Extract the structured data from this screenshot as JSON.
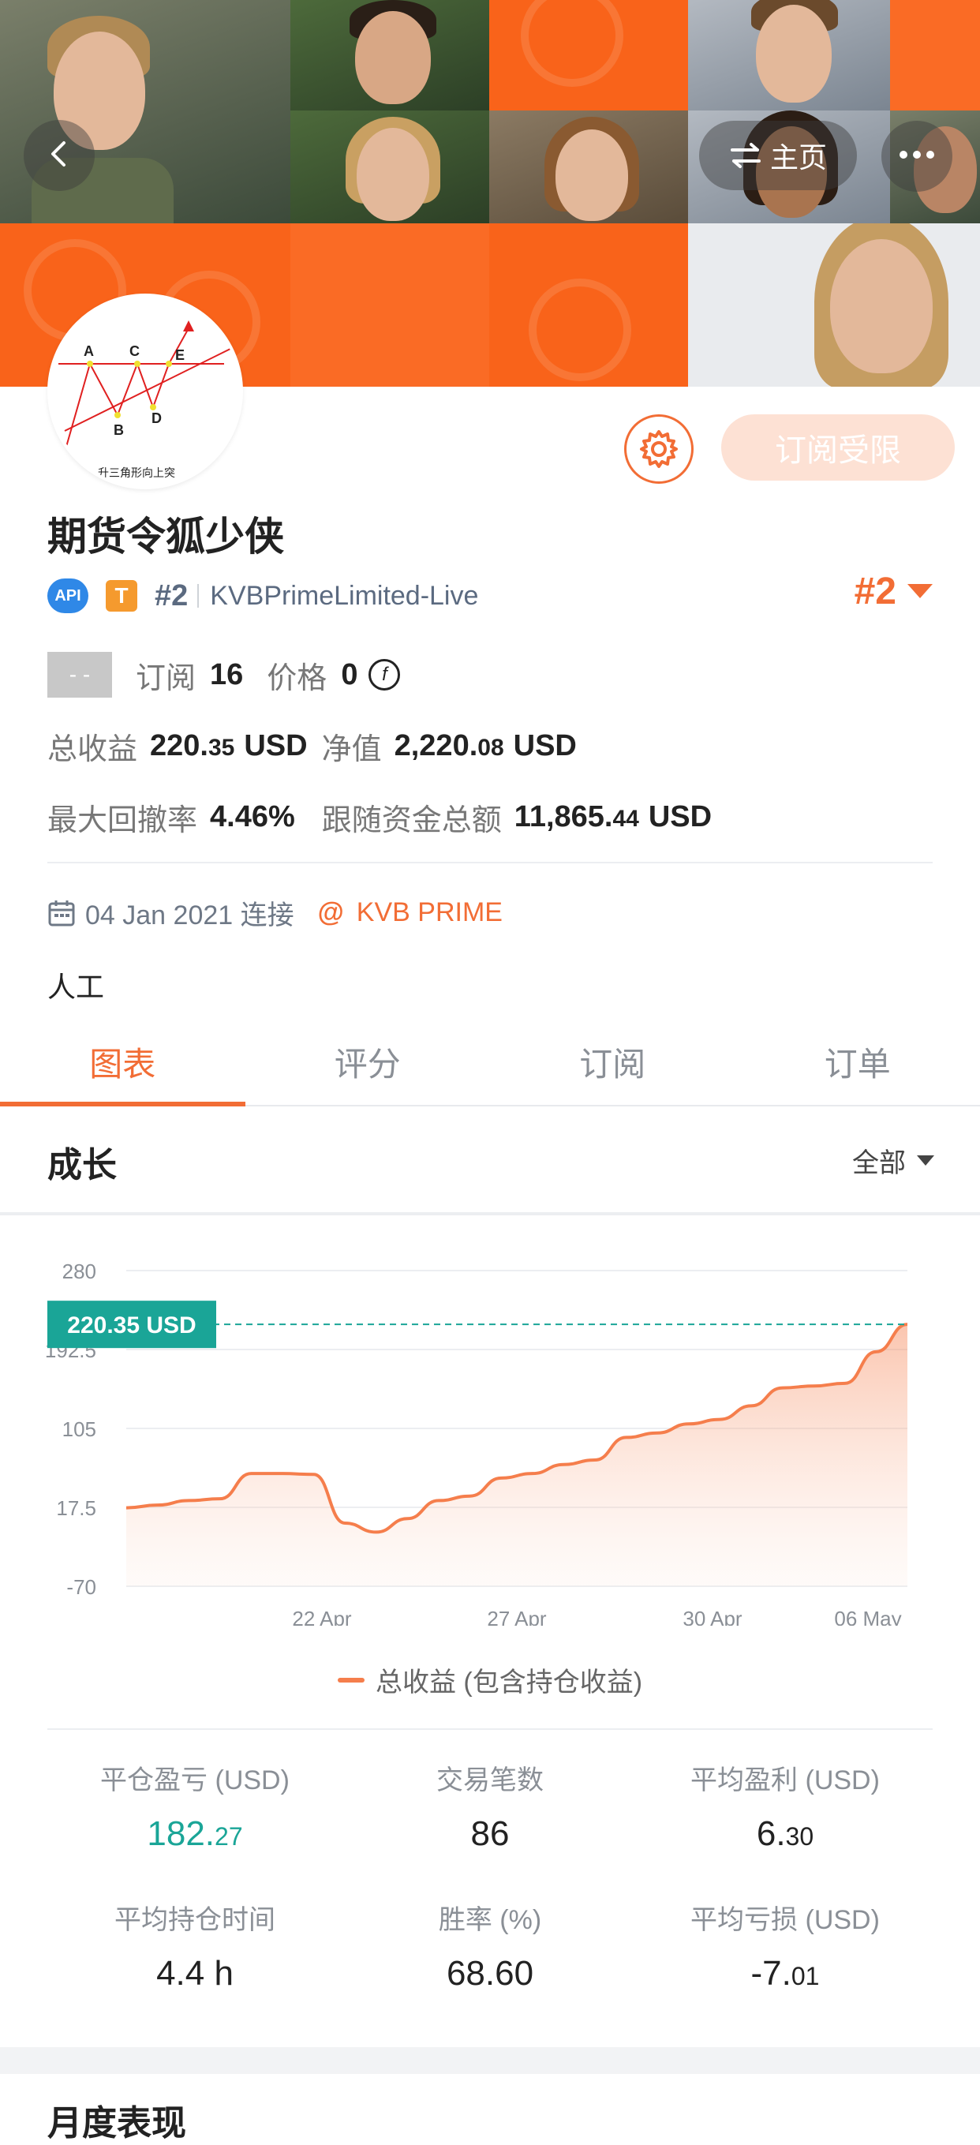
{
  "header": {
    "back_icon": "chevron-left-icon",
    "home_label": "主页",
    "swap_icon": "swap-arrows-icon",
    "more_icon": "more-dots-icon"
  },
  "profile": {
    "name": "期货令狐少侠",
    "avatar_labels": [
      "A",
      "C",
      "E",
      "B",
      "D"
    ],
    "avatar_caption": "升三角形向上突",
    "subscribe_label": "订阅受限",
    "api_badge": "API",
    "t_badge": "T",
    "rank_small": "#2",
    "account": "KVBPrimeLimited-Live",
    "rank_big": "#2"
  },
  "stats": {
    "placeholder_box": "- -",
    "subscribe_label": "订阅",
    "subscribe_count": "16",
    "price_label": "价格",
    "price_value": "0",
    "price_coin": "f",
    "total_profit_label": "总收益",
    "total_profit_int": "220.",
    "total_profit_frac": "35",
    "total_profit_unit": "USD",
    "equity_label": "净值",
    "equity_int": "2,220.",
    "equity_frac": "08",
    "equity_unit": "USD",
    "max_drawdown_label": "最大回撤率",
    "max_drawdown_value": "4.46%",
    "follow_funds_label": "跟随资金总额",
    "follow_funds_int": "11,865.",
    "follow_funds_frac": "44",
    "follow_funds_unit": "USD"
  },
  "connection": {
    "date_text": "04 Jan 2021 连接",
    "broker_at": "@",
    "broker": "KVB PRIME",
    "tag": "人工"
  },
  "tabs": [
    {
      "label": "图表",
      "active": true
    },
    {
      "label": "评分",
      "active": false
    },
    {
      "label": "订阅",
      "active": false
    },
    {
      "label": "订单",
      "active": false
    }
  ],
  "growth": {
    "title": "成长",
    "range": "全部"
  },
  "chart_data": {
    "type": "area",
    "y_ticks": [
      "280",
      "192.5",
      "105",
      "17.5",
      "-70"
    ],
    "ylim": [
      -70,
      280
    ],
    "x_ticks": [
      "22 Apr",
      "27 Apr",
      "30 Apr",
      "06 May"
    ],
    "current_label": "220.35 USD",
    "current_value": 220.35,
    "series": [
      {
        "name": "总收益 (包含持仓收益)",
        "values": [
          17,
          20,
          25,
          27,
          55,
          55,
          54,
          0,
          -10,
          5,
          25,
          30,
          50,
          55,
          65,
          70,
          95,
          100,
          110,
          115,
          130,
          150,
          152,
          155,
          190,
          220.35
        ]
      }
    ],
    "legend": "总收益 (包含持仓收益)",
    "colors": {
      "line": "#f57e4c",
      "fill": "#fde3d6",
      "marker": "#1aa597"
    }
  },
  "metrics": [
    {
      "label": "平仓盈亏 (USD)",
      "int": "182.",
      "frac": "27",
      "green": true
    },
    {
      "label": "交易笔数",
      "int": "86",
      "frac": "",
      "green": false
    },
    {
      "label": "平均盈利 (USD)",
      "int": "6.",
      "frac": "30",
      "green": false
    },
    {
      "label": "平均持仓时间",
      "int": "4.4 h",
      "frac": "",
      "green": false
    },
    {
      "label": "胜率 (%)",
      "int": "68.60",
      "frac": "",
      "green": false
    },
    {
      "label": "平均亏损 (USD)",
      "int": "-7.",
      "frac": "01",
      "green": false
    }
  ],
  "monthly_title": "月度表现"
}
